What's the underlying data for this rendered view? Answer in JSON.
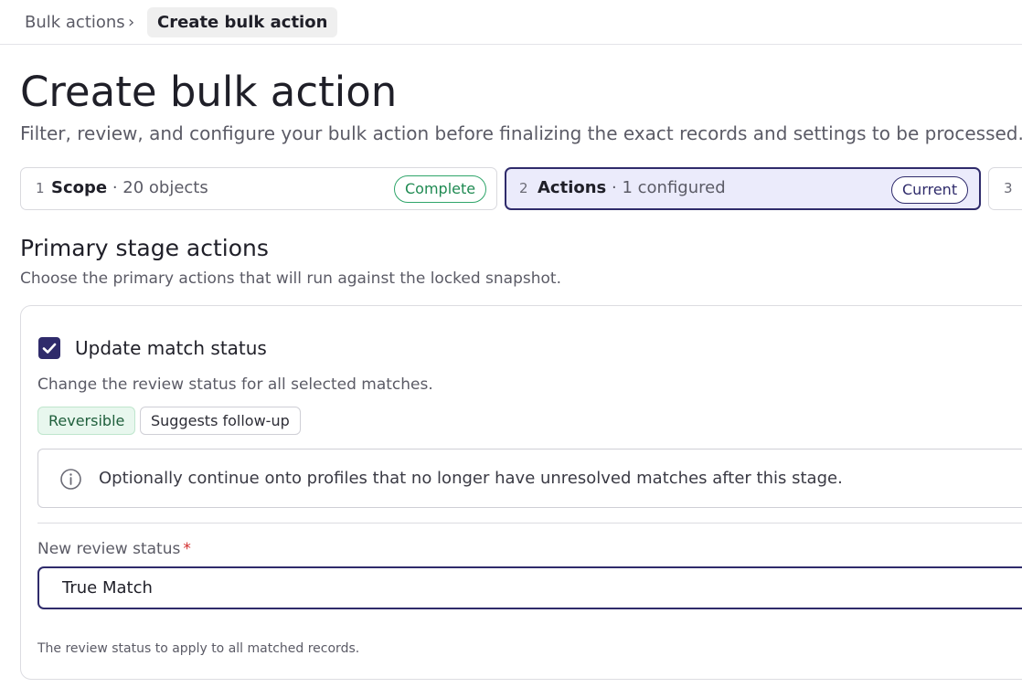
{
  "breadcrumb": {
    "parent": "Bulk actions",
    "separator": "›",
    "current": "Create bulk action"
  },
  "page": {
    "title": "Create bulk action",
    "subtitle": "Filter, review, and configure your bulk action before finalizing the exact records and settings to be processed."
  },
  "steps": [
    {
      "number": "1",
      "name": "Scope",
      "meta": " · 20 objects",
      "badge": "Complete",
      "state": "complete"
    },
    {
      "number": "2",
      "name": "Actions",
      "meta": " · 1 configured",
      "badge": "Current",
      "state": "current"
    },
    {
      "number": "3",
      "state": "upcoming"
    }
  ],
  "section": {
    "title": "Primary stage actions",
    "description": "Choose the primary actions that will run against the locked snapshot."
  },
  "action": {
    "checked": true,
    "title": "Update match status",
    "description": "Change the review status for all selected matches.",
    "tags": [
      "Reversible",
      "Suggests follow-up"
    ],
    "notice": "Optionally continue onto profiles that no longer have unresolved matches after this stage.",
    "notice_icon": "info-icon"
  },
  "field": {
    "label": "New review status",
    "required_mark": "*",
    "value": "True Match",
    "help": "The review status to apply to all matched records."
  },
  "colors": {
    "accent": "#2f2b6b",
    "current_step_bg": "#ebebfb",
    "complete_green": "#1f8a52",
    "required_red": "#d22c2c"
  }
}
